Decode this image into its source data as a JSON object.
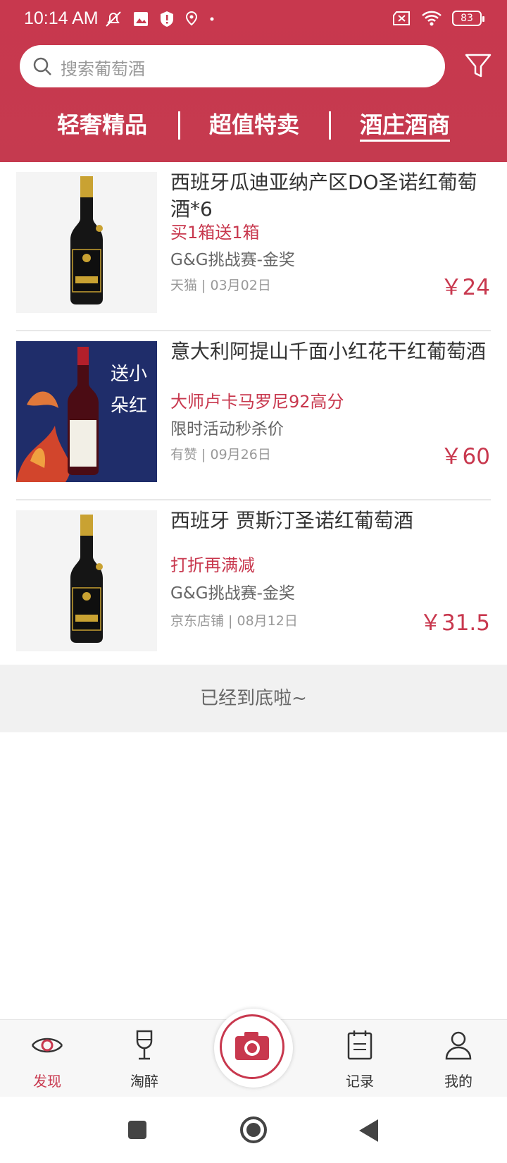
{
  "status_bar": {
    "time": "10:14 AM",
    "battery": "83"
  },
  "search": {
    "placeholder": "搜索葡萄酒"
  },
  "tabs": [
    {
      "label": "轻奢精品"
    },
    {
      "label": "超值特卖"
    },
    {
      "label": "酒庄酒商",
      "active": true
    }
  ],
  "products": [
    {
      "title": "西班牙瓜迪亚纳产区DO圣诺红葡萄酒*6",
      "promo": "买1箱送1箱",
      "award": "G&G挑战赛-金奖",
      "meta": "天猫 | 03月02日",
      "price": "￥24"
    },
    {
      "title": "意大利阿提山千面小红花干红葡萄酒",
      "promo": "大师卢卡马罗尼92高分",
      "award": "限时活动秒杀价",
      "meta": "有赞 | 09月26日",
      "price": "￥60",
      "image_text": "送你小红花"
    },
    {
      "title": "西班牙 贾斯汀圣诺红葡萄酒",
      "promo": "打折再满减",
      "award": "G&G挑战赛-金奖",
      "meta": "京东店铺 | 08月12日",
      "price": "￥31.5"
    }
  ],
  "end_text": "已经到底啦~",
  "bottom_nav": [
    {
      "label": "发现",
      "icon": "eye-icon",
      "active": true
    },
    {
      "label": "淘醉",
      "icon": "wine-glass-icon"
    },
    {
      "label": "",
      "icon": "camera-icon"
    },
    {
      "label": "记录",
      "icon": "notepad-icon"
    },
    {
      "label": "我的",
      "icon": "person-icon"
    }
  ],
  "colors": {
    "primary": "#c8384e",
    "background": "#ffffff",
    "divider": "#e8e8e8"
  }
}
